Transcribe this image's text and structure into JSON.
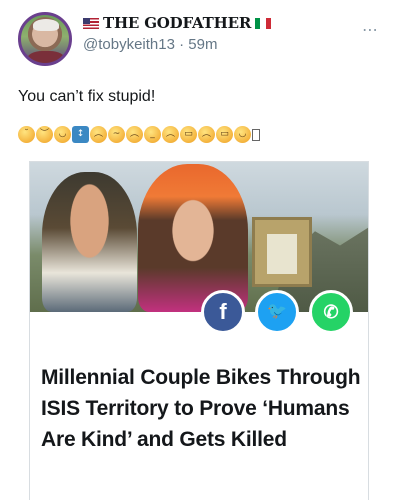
{
  "tweet": {
    "author_name": "THE GODFATHER",
    "handle": "@tobykeith13",
    "separator": "·",
    "time": "59m",
    "text": "You can’t fix stupid!",
    "more_icon": "⋯"
  },
  "emoji_row": [
    "unamused-face",
    "disappointed-face",
    "slightly-smiling-face",
    "up-down-arrow",
    "slightly-frowning-face",
    "confused-face",
    "worried-face",
    "pensive-face",
    "frowning-face",
    "weary-face",
    "crying-face",
    "loudly-crying-face",
    "face-with-tears-of-joy",
    "unsupported-glyph"
  ],
  "card": {
    "headline": "Millennial Couple Bikes Through ISIS Territory to Prove ‘Humans Are Kind’ and Gets Killed",
    "share": {
      "facebook": "f",
      "twitter": "🐦",
      "whatsapp": "✆"
    }
  },
  "colors": {
    "facebook": "#3b5998",
    "twitter": "#1da1f2",
    "whatsapp": "#25d366",
    "handle_gray": "#657786"
  }
}
